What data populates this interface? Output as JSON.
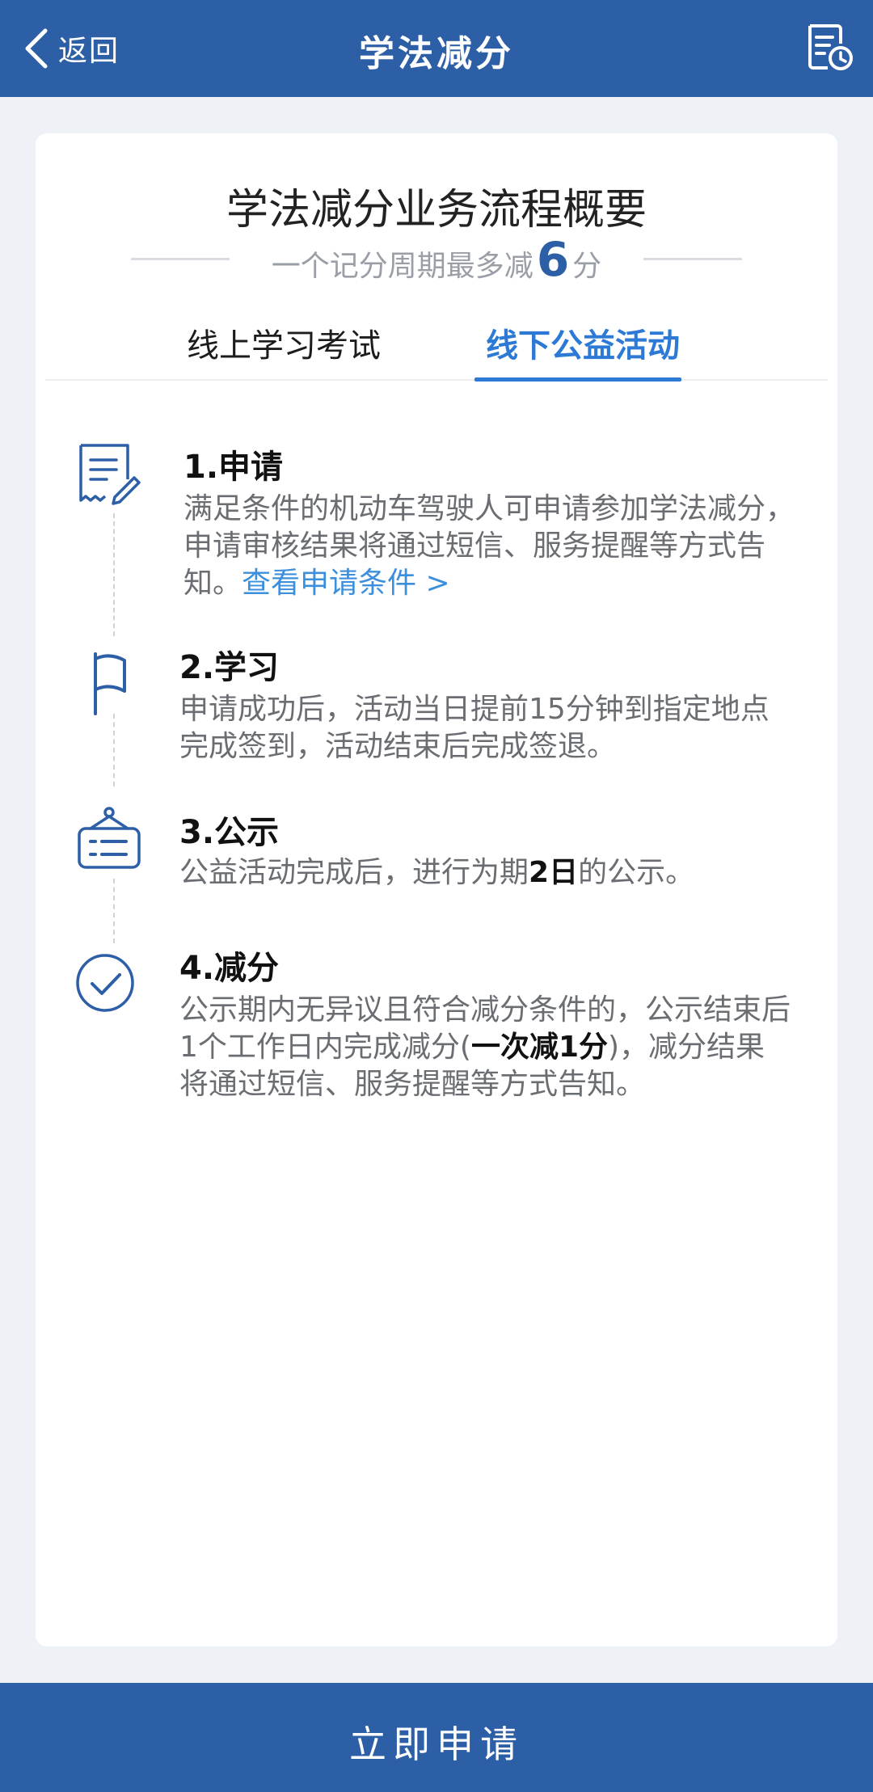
{
  "header": {
    "back_label": "返回",
    "title": "学法减分",
    "right_icon": "record-history-icon"
  },
  "summary": {
    "title": "学法减分业务流程概要",
    "subtitle_prefix": "一个记分周期最多减",
    "subtitle_number": "6",
    "subtitle_suffix": "分"
  },
  "tabs": [
    {
      "label": "线上学习考试",
      "selected": false
    },
    {
      "label": "线下公益活动",
      "selected": true
    }
  ],
  "steps": [
    {
      "title": "1.申请",
      "icon": "form-edit-icon",
      "desc": "满足条件的机动车驾驶人可申请参加学法减分，申请审核结果将通过短信、服务提醒等方式告知。",
      "link": "查看申请条件 >"
    },
    {
      "title": "2.学习",
      "icon": "flag-icon",
      "desc": "申请成功后，活动当日提前15分钟到指定地点完成签到，活动结束后完成签退。"
    },
    {
      "title": "3.公示",
      "icon": "notice-board-icon",
      "desc_before": "公益活动完成后，进行为期",
      "desc_strong": "2日",
      "desc_after": "的公示。"
    },
    {
      "title": "4.减分",
      "icon": "check-circle-icon",
      "desc_before": "公示期内无异议且符合减分条件的，公示结束后1个工作日内完成减分(",
      "desc_strong": "一次减1分",
      "desc_after": ")，减分结果将通过短信、服务提醒等方式告知。"
    }
  ],
  "footer": {
    "apply_label": "立即申请"
  },
  "colors": {
    "brand": "#2d5fa6",
    "accent": "#2d7ad6",
    "link": "#3c8fdc"
  }
}
